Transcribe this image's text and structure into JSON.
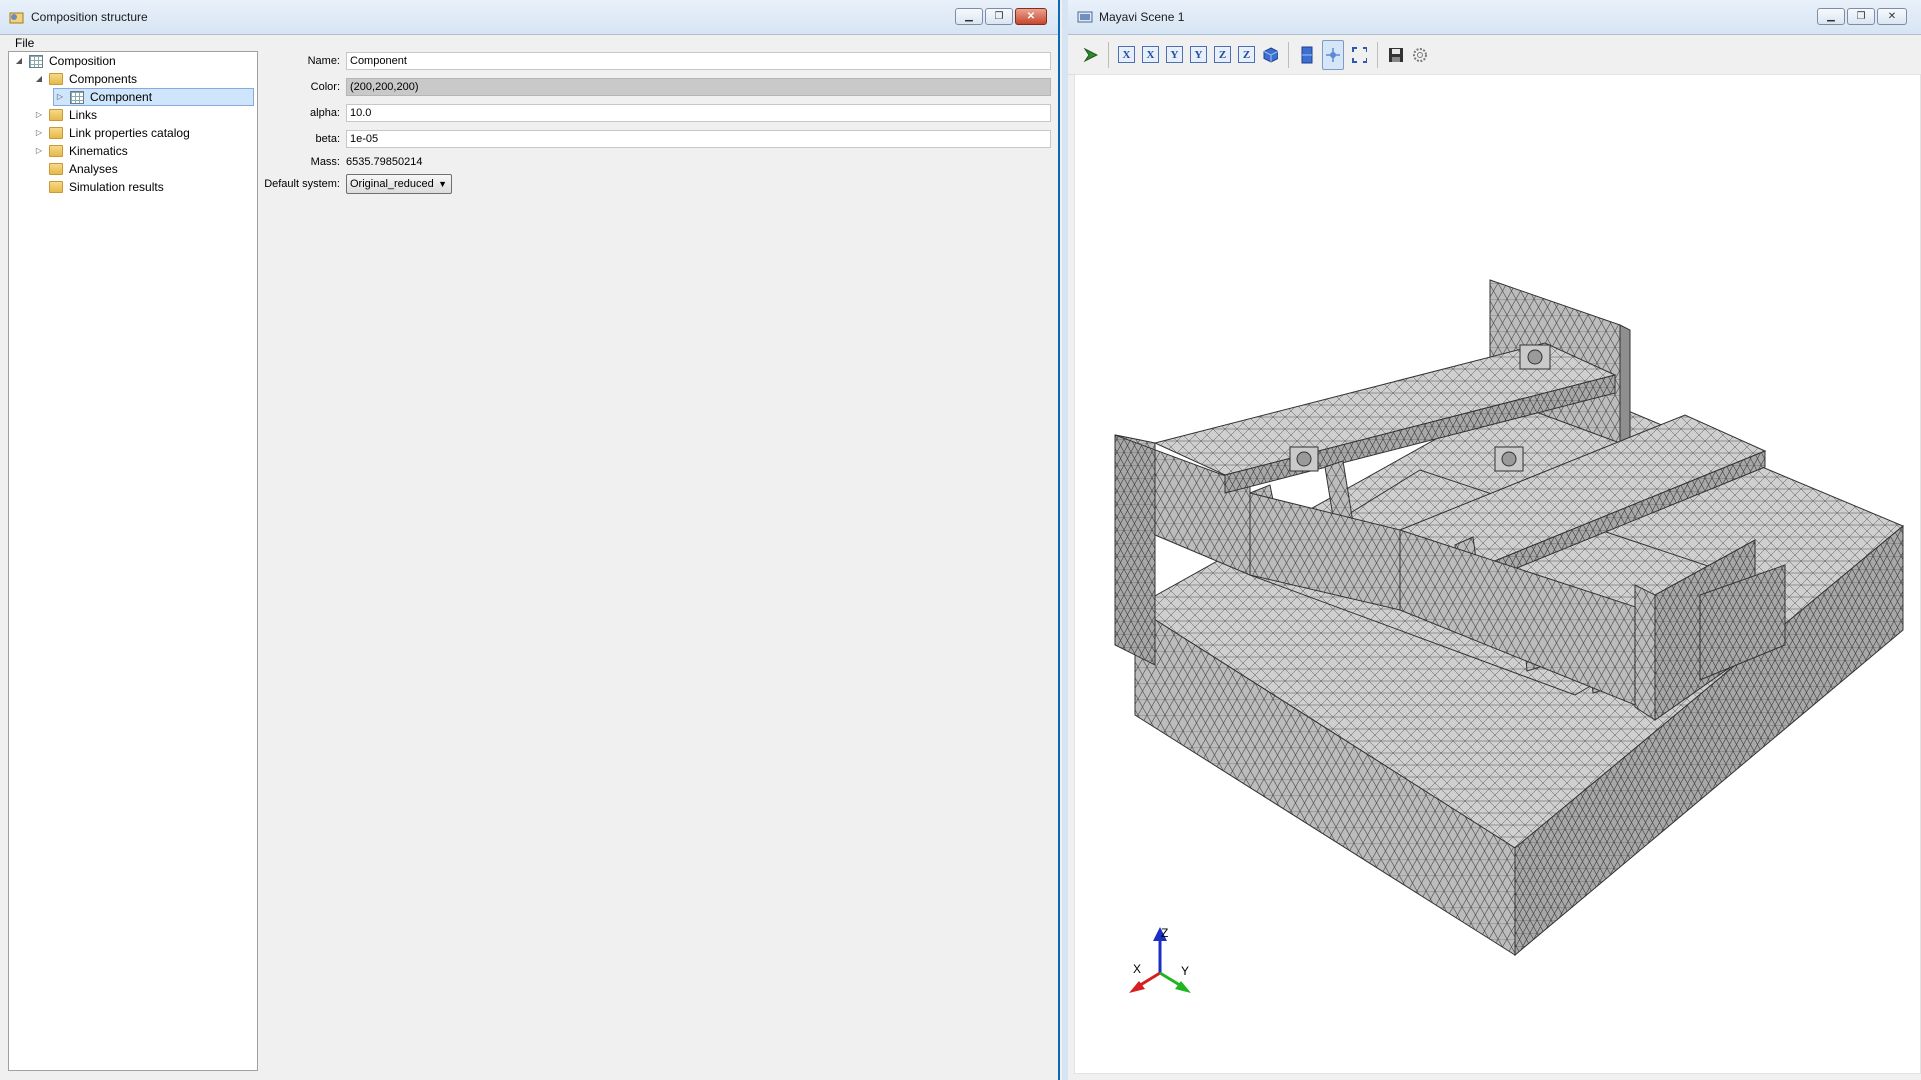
{
  "left_window": {
    "title": "Composition structure",
    "menu": [
      "File"
    ],
    "tree": [
      {
        "label": "Composition",
        "level": 0,
        "expander": "◢",
        "icon": "composition-icon"
      },
      {
        "label": "Components",
        "level": 1,
        "expander": "◢",
        "icon": "folder-icon"
      },
      {
        "label": "Component",
        "level": 2,
        "expander": "▷",
        "icon": "component-icon",
        "selected": true
      },
      {
        "label": "Links",
        "level": 1,
        "expander": "▷",
        "icon": "folder-icon"
      },
      {
        "label": "Link properties catalog",
        "level": 1,
        "expander": "▷",
        "icon": "folder-icon"
      },
      {
        "label": "Kinematics",
        "level": 1,
        "expander": "▷",
        "icon": "folder-icon"
      },
      {
        "label": "Analyses",
        "level": 1,
        "expander": "",
        "icon": "folder-icon"
      },
      {
        "label": "Simulation results",
        "level": 1,
        "expander": "",
        "icon": "folder-icon"
      }
    ],
    "props": {
      "name_label": "Name:",
      "name_value": "Component",
      "color_label": "Color:",
      "color_value": "(200,200,200)",
      "alpha_label": "alpha:",
      "alpha_value": "10.0",
      "beta_label": "beta:",
      "beta_value": "1e-05",
      "mass_label": "Mass:",
      "mass_value": "6535.79850214",
      "default_system_label": "Default system:",
      "default_system_value": "Original_reduced"
    }
  },
  "right_window": {
    "title": "Mayavi Scene 1",
    "toolbar": [
      "pipeline-icon",
      "view-x-pos",
      "view-x-neg",
      "view-y-pos",
      "view-y-neg",
      "view-z-pos",
      "view-z-neg",
      "isometric-icon",
      "parallel-projection-icon",
      "interaction-mode-icon",
      "full-screen-icon",
      "save-icon",
      "configure-icon"
    ],
    "toolbar_letters": {
      "x": "X",
      "y": "Y",
      "z": "Z"
    },
    "axes": {
      "x": "X",
      "y": "Y",
      "z": "Z"
    }
  },
  "colors": {
    "mesh_fill": "#b8b8b8",
    "mesh_edge": "#3a3a3a",
    "axis_x": "#d61f1f",
    "axis_y": "#1fb51f",
    "axis_z": "#1c2fc4",
    "selection": "#cfe5fb"
  }
}
